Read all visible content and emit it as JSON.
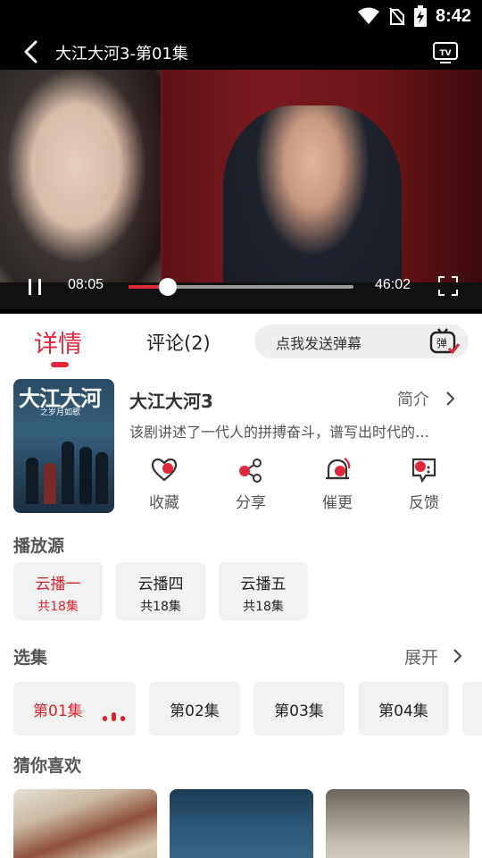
{
  "status": {
    "time": "8:42",
    "icons": [
      "wifi-icon",
      "no-sim-icon",
      "battery-charging-icon"
    ]
  },
  "player": {
    "title": "大江大河3-第01集",
    "current_time": "08:05",
    "total_time": "46:02",
    "progress": 0.175
  },
  "tabs": {
    "detail": "详情",
    "comments": "评论(2)"
  },
  "danmu": {
    "placeholder": "点我发送弹幕",
    "icon_text": "弹"
  },
  "show": {
    "title": "大江大河3",
    "intro_label": "简介",
    "description": "该剧讲述了一代人的拼搏奋斗，谱写出时代的…",
    "poster_title": "大江大河",
    "poster_subtitle": "之岁月如歌"
  },
  "actions": [
    {
      "label": "收藏",
      "icon": "heart-icon"
    },
    {
      "label": "分享",
      "icon": "share-icon"
    },
    {
      "label": "催更",
      "icon": "bell-icon"
    },
    {
      "label": "反馈",
      "icon": "feedback-icon"
    }
  ],
  "sources": {
    "title": "播放源",
    "items": [
      {
        "name": "云播一",
        "count": "共18集"
      },
      {
        "name": "云播四",
        "count": "共18集"
      },
      {
        "name": "云播五",
        "count": "共18集"
      }
    ]
  },
  "episodes": {
    "title": "选集",
    "expand_label": "展开",
    "items": [
      "第01集",
      "第02集",
      "第03集",
      "第04集"
    ]
  },
  "recommend": {
    "title": "猜你喜欢"
  },
  "colors": {
    "accent": "#e0283b",
    "chip_bg": "#f2f2f2"
  }
}
